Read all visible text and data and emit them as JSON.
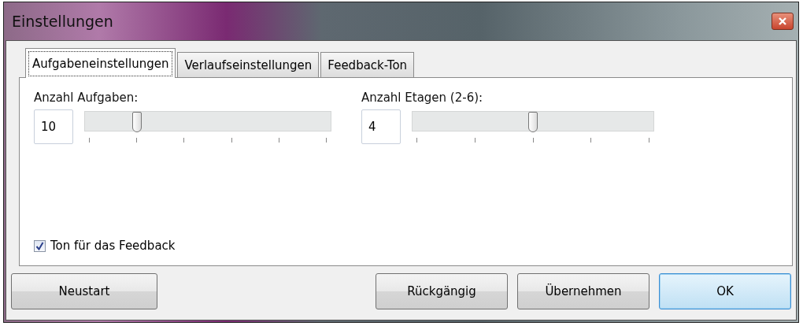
{
  "window": {
    "title": "Einstellungen"
  },
  "tabs": [
    {
      "label": "Aufgabeneinstellungen",
      "selected": true
    },
    {
      "label": "Verlaufseinstellungen",
      "selected": false
    },
    {
      "label": "Feedback-Ton",
      "selected": false
    }
  ],
  "sliders": [
    {
      "label": "Anzahl Aufgaben:",
      "value": "10",
      "level": 0.2
    },
    {
      "label": "Anzahl Etagen (2-6):",
      "value": "4",
      "level": 0.5
    }
  ],
  "checkbox": {
    "label": "Ton für das Feedback",
    "checked": true
  },
  "buttons": [
    {
      "label": "Neustart",
      "kind": "left",
      "default": false
    },
    {
      "label": "Rückgängig",
      "kind": "right",
      "default": false
    },
    {
      "label": "Übernehmen",
      "kind": "right",
      "default": false
    },
    {
      "label": "OK",
      "kind": "right",
      "default": true
    }
  ]
}
